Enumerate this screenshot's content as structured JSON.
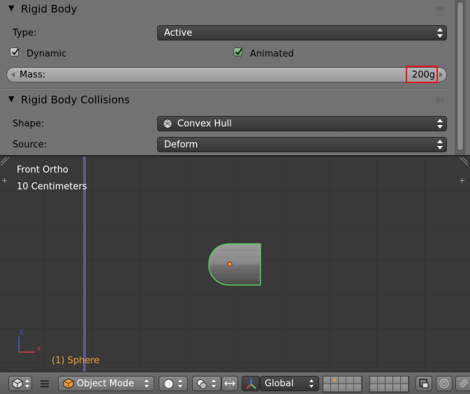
{
  "rigid_body": {
    "title": "Rigid Body",
    "type_label": "Type:",
    "type_value": "Active",
    "dynamic_label": "Dynamic",
    "dynamic_checked": true,
    "animated_label": "Animated",
    "animated_checked": true,
    "mass_label": "Mass:",
    "mass_value": "200g"
  },
  "collisions": {
    "title": "Rigid Body Collisions",
    "shape_label": "Shape:",
    "shape_value": "Convex Hull",
    "source_label": "Source:",
    "source_value": "Deform"
  },
  "viewport": {
    "view_name": "Front Ortho",
    "grid_scale": "10 Centimeters",
    "object_label": "(1) Sphere",
    "axis_z": "z",
    "axis_x": "x"
  },
  "header": {
    "mode_label": "Object Mode",
    "orientation_label": "Global"
  },
  "colors": {
    "accent_orange": "#f0a236",
    "highlight_red": "#e8141b",
    "selection_green": "#4fd14f"
  }
}
